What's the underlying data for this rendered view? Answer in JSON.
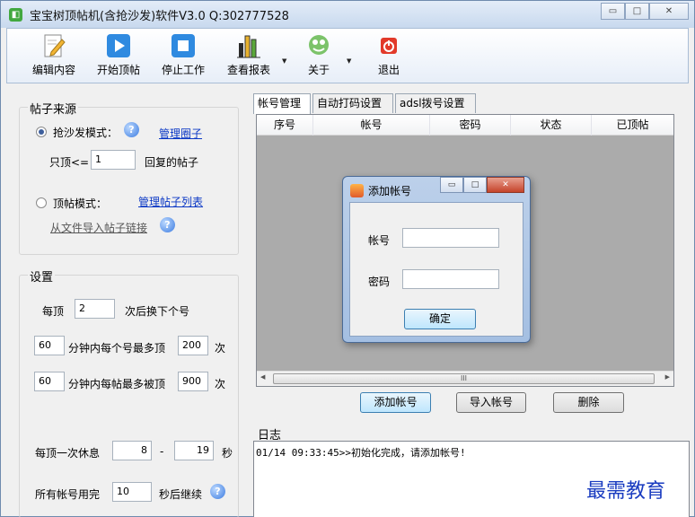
{
  "window": {
    "title": "宝宝树顶帖机(含抢沙发)软件V3.0 Q:302777528",
    "minimize": "▭",
    "maximize": "□",
    "close": "✕"
  },
  "toolbar": {
    "items": [
      {
        "label": "编辑内容",
        "icon": "edit-pencil-icon"
      },
      {
        "label": "开始顶帖",
        "icon": "play-icon"
      },
      {
        "label": "停止工作",
        "icon": "stop-icon"
      },
      {
        "label": "查看报表",
        "icon": "bar-chart-icon"
      },
      {
        "label": "关于",
        "icon": "about-icon"
      },
      {
        "label": "退出",
        "icon": "power-icon"
      }
    ]
  },
  "source_group": {
    "title": "帖子来源",
    "mode_sofa_label": "抢沙发模式：",
    "manage_circle_link": "管理圈子",
    "only_top_prefix": "只顶<=",
    "only_top_value": "1",
    "only_top_suffix": "回复的帖子",
    "mode_top_label": "顶帖模式：",
    "manage_list_link": "管理帖子列表",
    "import_link": "从文件导入帖子链接",
    "help_glyph": "?"
  },
  "settings_group": {
    "title": "设置",
    "per_top_prefix": "每顶",
    "per_top_value": "2",
    "per_top_suffix": "次后换下个号",
    "minutes_each_value": "60",
    "minutes_each_text": "分钟内每个号最多顶",
    "max_each_value": "200",
    "times_label_1": "次",
    "minutes_post_value": "60",
    "minutes_post_text": "分钟内每帖最多被顶",
    "max_post_value": "900",
    "times_label_2": "次",
    "rest_label": "每顶一次休息",
    "rest_min": "8",
    "rest_dash": "-",
    "rest_max": "19",
    "rest_unit": "秒",
    "all_used_label": "所有帐号用完",
    "all_used_value": "10",
    "all_used_suffix": "秒后继续"
  },
  "tabs": [
    "帐号管理",
    "自动打码设置",
    "adsl拨号设置"
  ],
  "account_table": {
    "columns": [
      "序号",
      "帐号",
      "密码",
      "状态",
      "已顶帖"
    ],
    "rows": []
  },
  "scroll_grip": "III",
  "account_buttons": {
    "add": "添加帐号",
    "import": "导入帐号",
    "delete": "删除"
  },
  "dialog": {
    "title": "添加帐号",
    "account_label": "帐号",
    "account_value": "",
    "password_label": "密码",
    "password_value": "",
    "confirm": "确定"
  },
  "log": {
    "title": "日志",
    "lines": [
      "01/14 09:33:45>>初始化完成，请添加帐号!"
    ]
  },
  "watermark": "最需教育",
  "colors": {
    "link": "#0b38c5",
    "listview_bg": "#ababab",
    "watermark": "#1a3cc0"
  }
}
